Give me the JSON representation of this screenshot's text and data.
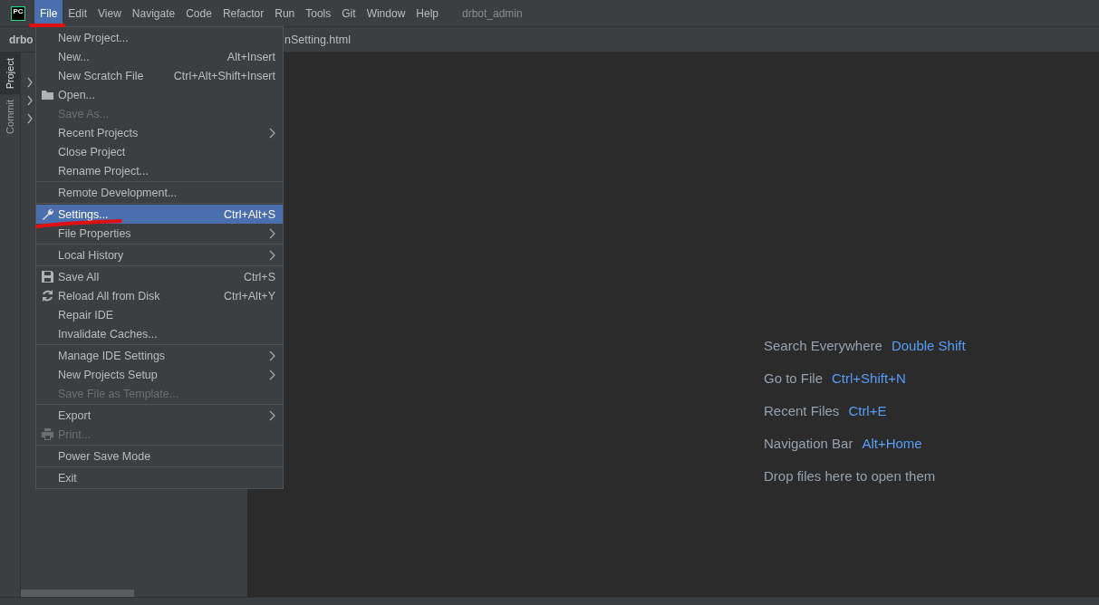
{
  "menubar": {
    "items": [
      {
        "label": "File",
        "selected": true
      },
      {
        "label": "Edit",
        "selected": false
      },
      {
        "label": "View",
        "selected": false
      },
      {
        "label": "Navigate",
        "selected": false
      },
      {
        "label": "Code",
        "selected": false
      },
      {
        "label": "Refactor",
        "selected": false
      },
      {
        "label": "Run",
        "selected": false
      },
      {
        "label": "Tools",
        "selected": false
      },
      {
        "label": "Git",
        "selected": false
      },
      {
        "label": "Window",
        "selected": false
      },
      {
        "label": "Help",
        "selected": false
      }
    ],
    "project_title": "drbot_admin"
  },
  "logo": "PC",
  "navbar": {
    "project": "drbo",
    "tab": "nSetting.html"
  },
  "tool_stripe": [
    {
      "label": "Project",
      "selected": true
    },
    {
      "label": "Commit",
      "selected": false
    }
  ],
  "file_menu": [
    [
      {
        "label": "New Project...",
        "selected": false,
        "disabled": false,
        "submenu": false
      },
      {
        "label": "New...",
        "shortcut": "Alt+Insert",
        "selected": false,
        "disabled": false,
        "submenu": false
      },
      {
        "label": "New Scratch File",
        "shortcut": "Ctrl+Alt+Shift+Insert",
        "selected": false,
        "disabled": false,
        "submenu": false
      },
      {
        "label": "Open...",
        "selected": false,
        "disabled": false,
        "submenu": false
      },
      {
        "label": "Save As...",
        "selected": false,
        "disabled": true,
        "submenu": false
      },
      {
        "label": "Recent Projects",
        "selected": false,
        "disabled": false,
        "submenu": true
      },
      {
        "label": "Close Project",
        "selected": false,
        "disabled": false,
        "submenu": false
      },
      {
        "label": "Rename Project...",
        "selected": false,
        "disabled": false,
        "submenu": false
      }
    ],
    [
      {
        "label": "Remote Development...",
        "selected": false,
        "disabled": false,
        "submenu": false
      }
    ],
    [
      {
        "label": "Settings...",
        "shortcut": "Ctrl+Alt+S",
        "selected": true,
        "disabled": false,
        "submenu": false
      },
      {
        "label": "File Properties",
        "selected": false,
        "disabled": false,
        "submenu": true
      }
    ],
    [
      {
        "label": "Local History",
        "selected": false,
        "disabled": false,
        "submenu": true
      }
    ],
    [
      {
        "label": "Save All",
        "shortcut": "Ctrl+S",
        "selected": false,
        "disabled": false,
        "submenu": false
      },
      {
        "label": "Reload All from Disk",
        "shortcut": "Ctrl+Alt+Y",
        "selected": false,
        "disabled": false,
        "submenu": false
      },
      {
        "label": "Repair IDE",
        "selected": false,
        "disabled": false,
        "submenu": false
      },
      {
        "label": "Invalidate Caches...",
        "selected": false,
        "disabled": false,
        "submenu": false
      }
    ],
    [
      {
        "label": "Manage IDE Settings",
        "selected": false,
        "disabled": false,
        "submenu": true
      },
      {
        "label": "New Projects Setup",
        "selected": false,
        "disabled": false,
        "submenu": true
      },
      {
        "label": "Save File as Template...",
        "selected": false,
        "disabled": true,
        "submenu": false
      }
    ],
    [
      {
        "label": "Export",
        "selected": false,
        "disabled": false,
        "submenu": true
      },
      {
        "label": "Print...",
        "selected": false,
        "disabled": true,
        "submenu": false
      }
    ],
    [
      {
        "label": "Power Save Mode",
        "selected": false,
        "disabled": false,
        "submenu": false
      }
    ],
    [
      {
        "label": "Exit",
        "selected": false,
        "disabled": false,
        "submenu": false
      }
    ]
  ],
  "editor_hints": [
    {
      "action": "Search Everywhere",
      "shortcut": "Double Shift"
    },
    {
      "action": "Go to File",
      "shortcut": "Ctrl+Shift+N"
    },
    {
      "action": "Recent Files",
      "shortcut": "Ctrl+E"
    },
    {
      "action": "Navigation Bar",
      "shortcut": "Alt+Home"
    },
    {
      "action": "Drop files here to open them"
    }
  ]
}
